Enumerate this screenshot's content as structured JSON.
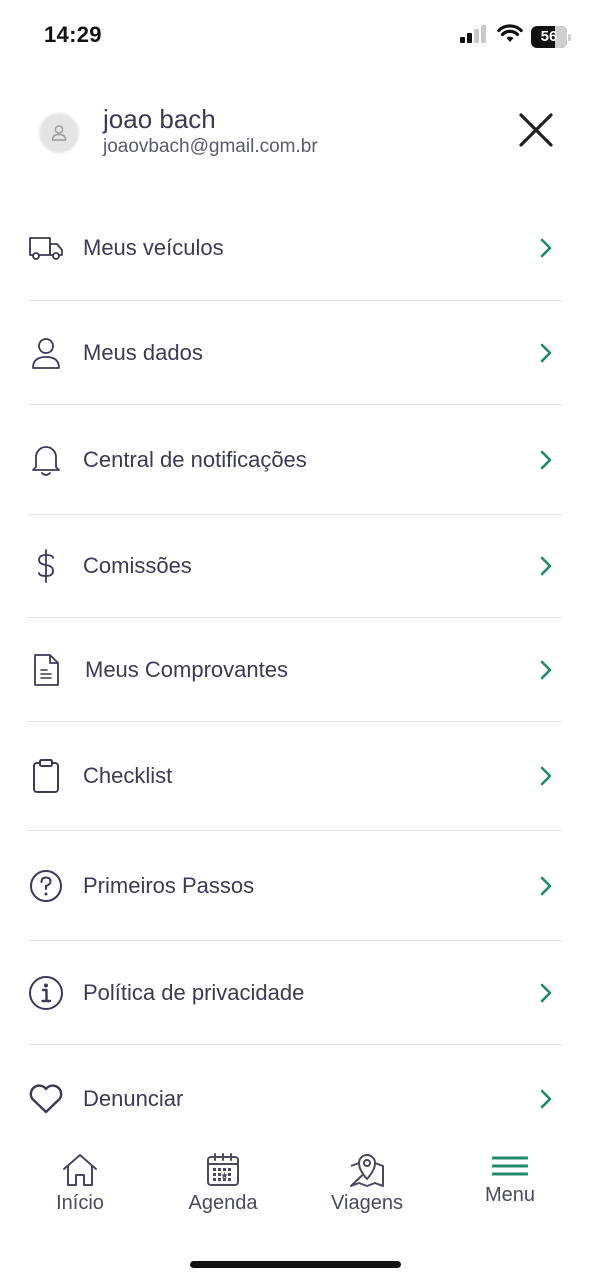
{
  "status_bar": {
    "time": "14:29",
    "battery_level": "56"
  },
  "profile": {
    "name": "joao bach",
    "email": "joaovbach@gmail.com.br"
  },
  "menu": {
    "items": [
      {
        "label": "Meus veículos",
        "icon": "truck-icon"
      },
      {
        "label": "Meus dados",
        "icon": "user-icon"
      },
      {
        "label": "Central de notificações",
        "icon": "bell-icon"
      },
      {
        "label": "Comissões",
        "icon": "dollar-icon"
      },
      {
        "label": "Meus Comprovantes",
        "icon": "document-icon"
      },
      {
        "label": "Checklist",
        "icon": "clipboard-icon"
      },
      {
        "label": "Primeiros Passos",
        "icon": "help-circle-icon"
      },
      {
        "label": "Política de privacidade",
        "icon": "info-circle-icon"
      },
      {
        "label": "Denunciar",
        "icon": "heart-icon"
      }
    ]
  },
  "tab_bar": {
    "tabs": [
      {
        "label": "Início",
        "icon": "home-icon"
      },
      {
        "label": "Agenda",
        "icon": "calendar-icon"
      },
      {
        "label": "Viagens",
        "icon": "map-pin-icon"
      },
      {
        "label": "Menu",
        "icon": "menu-icon",
        "active": true
      }
    ]
  },
  "colors": {
    "accent": "#1e8a6a",
    "text": "#3b3a55",
    "divider": "#e3e3e3"
  }
}
